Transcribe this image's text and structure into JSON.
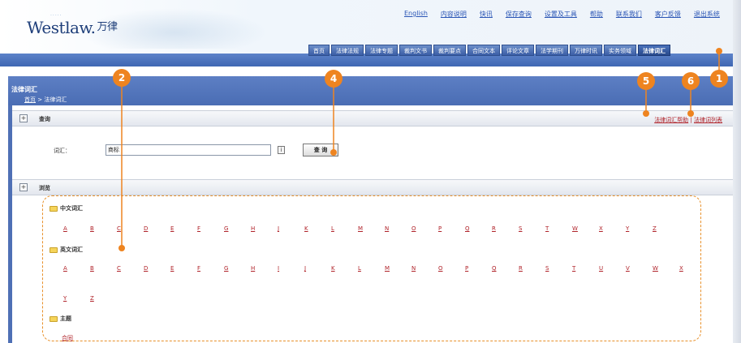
{
  "header": {
    "logo_text": "Westlaw.",
    "logo_cn": "万律",
    "top_links": [
      "English",
      "内容说明",
      "快讯",
      "保存查询",
      "设置及工具",
      "帮助",
      "联系我们",
      "客户反馈",
      "退出系统"
    ],
    "nav_tabs": [
      "首页",
      "法律法规",
      "法律专题",
      "裁判文书",
      "裁判要点",
      "合同文本",
      "评论文章",
      "法学期刊",
      "万律时讯",
      "实务领域",
      "法律词汇"
    ],
    "active_tab": "法律词汇"
  },
  "page": {
    "title": "法律词汇",
    "breadcrumb_home": "首页",
    "breadcrumb_sep": " > ",
    "breadcrumb_current": "法律词汇"
  },
  "query_section": {
    "toggle": "+",
    "label": "查询",
    "help_link": "法律词汇帮助",
    "link_sep": " | ",
    "list_link": "法律词列表",
    "vocab_label": "词汇：",
    "input_value": "商标",
    "info_icon": "i",
    "query_button": "查 询"
  },
  "browse_section": {
    "toggle": "+",
    "label": "浏览",
    "chinese_vocab": {
      "label": "中文词汇",
      "letters": [
        "A",
        "B",
        "C",
        "D",
        "E",
        "F",
        "G",
        "H",
        "J",
        "K",
        "L",
        "M",
        "N",
        "O",
        "P",
        "Q",
        "R",
        "S",
        "T",
        "W",
        "X",
        "Y",
        "Z"
      ]
    },
    "english_vocab": {
      "label": "英文词汇",
      "letters_row1": [
        "A",
        "B",
        "C",
        "D",
        "E",
        "F",
        "G",
        "H",
        "I",
        "J",
        "K",
        "L",
        "M",
        "N",
        "O",
        "P",
        "Q",
        "R",
        "S",
        "T",
        "U",
        "V",
        "W",
        "X"
      ],
      "letters_row2": [
        "Y",
        "Z"
      ]
    },
    "topic": {
      "label": "主题",
      "first_item": "合同"
    }
  },
  "annotations": {
    "badges": [
      "1",
      "2",
      "4",
      "5",
      "6"
    ]
  },
  "colors": {
    "accent_orange": "#ee8420",
    "nav_blue": "#3f67b3",
    "link_red": "#b0232a"
  }
}
